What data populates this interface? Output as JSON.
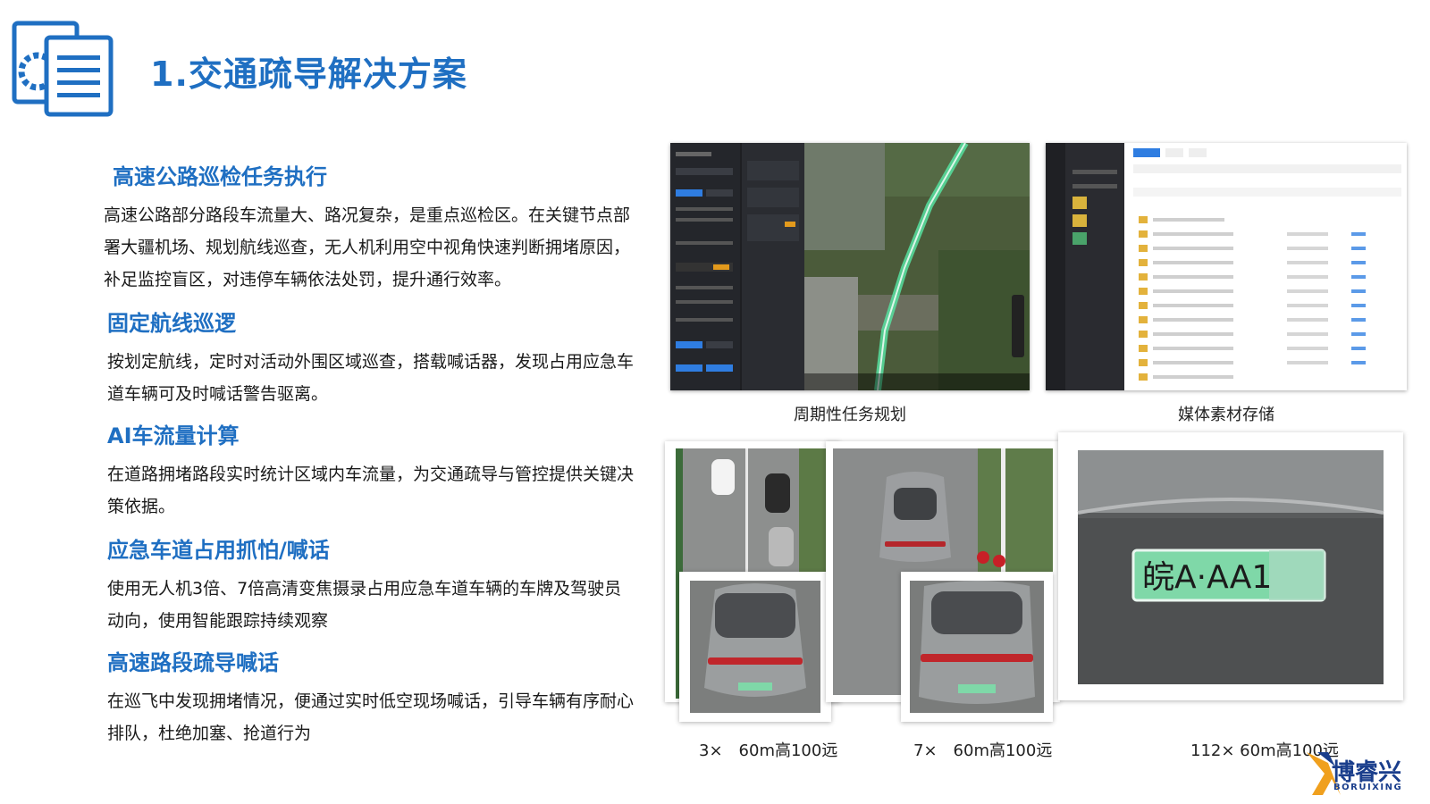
{
  "page": {
    "title": "1.交通疏导解决方案"
  },
  "sections": [
    {
      "heading": "高速公路巡检任务执行",
      "body": "高速公路部分路段车流量大、路况复杂，是重点巡检区。在关键节点部署大疆机场、规划航线巡查，无人机利用空中视角快速判断拥堵原因，补足监控盲区，对违停车辆依法处罚，提升通行效率。"
    },
    {
      "heading": "固定航线巡逻",
      "body": "按划定航线，定时对活动外围区域巡查，搭载喊话器，发现占用应急车道车辆可及时喊话警告驱离。"
    },
    {
      "heading": "AI车流量计算",
      "body": "在道路拥堵路段实时统计区域内车流量，为交通疏导与管控提供关键决策依据。"
    },
    {
      "heading": "应急车道占用抓怕/喊话",
      "body": "使用无人机3倍、7倍高清变焦摄录占用应急车道车辆的车牌及驾驶员动向，使用智能跟踪持续观察"
    },
    {
      "heading": "高速路段疏导喊话",
      "body": "在巡飞中发现拥堵情况，便通过实时低空现场喊话，引导车辆有序耐心排队，杜绝加塞、抢道行为"
    }
  ],
  "figures": {
    "task_planning_caption": "周期性任务规划",
    "media_storage_caption": "媒体素材存储",
    "zoom_3x_caption": "3×　60m高100远",
    "zoom_7x_caption": "7×　60m高100远",
    "zoom_112x_caption": "112× 60m高100远",
    "plate_text": "皖A·AA1"
  },
  "logo": {
    "name": "博睿兴",
    "sub": "BORUIXING"
  },
  "colors": {
    "accent": "#1f6fc2",
    "logo": "#1a3e8c",
    "plate": "#7fd8a8"
  }
}
